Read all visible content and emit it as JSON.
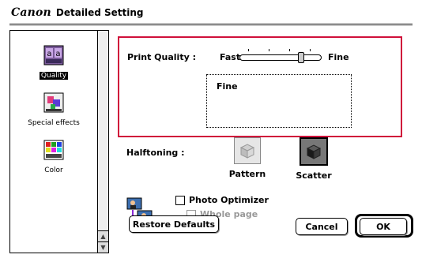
{
  "window": {
    "brand": "Canon",
    "title": "Detailed Setting"
  },
  "sidebar": {
    "items": [
      {
        "label": "Quality",
        "icon": "quality-icon",
        "selected": true
      },
      {
        "label": "Special effects",
        "icon": "special-effects-icon",
        "selected": false
      },
      {
        "label": "Color",
        "icon": "color-icon",
        "selected": false
      }
    ]
  },
  "print_quality": {
    "label": "Print Quality :",
    "min_label": "Fast",
    "max_label": "Fine",
    "level": 0.75,
    "description": "Fine"
  },
  "halftoning": {
    "label": "Halftoning :",
    "options": [
      {
        "label": "Pattern",
        "selected": false
      },
      {
        "label": "Scatter",
        "selected": true
      }
    ]
  },
  "photo_optimizer": {
    "label": "Photo Optimizer",
    "checked": false,
    "whole_page_label": "Whole page",
    "whole_page_checked": false,
    "whole_page_enabled": false
  },
  "buttons": {
    "restore_defaults": "Restore Defaults",
    "cancel": "Cancel",
    "ok": "OK"
  },
  "colors": {
    "highlight_border": "#d0103a"
  }
}
